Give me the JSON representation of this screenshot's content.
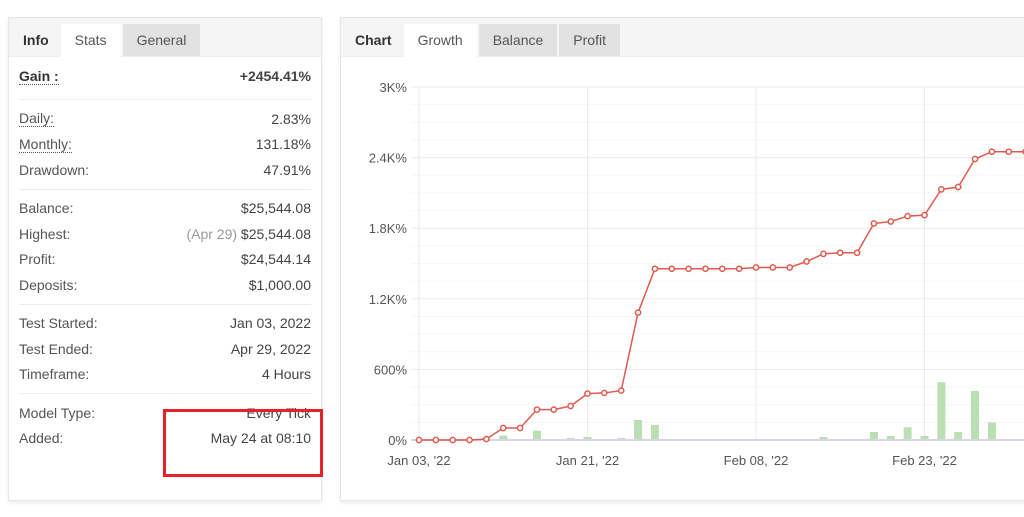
{
  "left_panel": {
    "tabs": [
      {
        "label": "Info"
      },
      {
        "label": "Stats"
      },
      {
        "label": "General"
      }
    ],
    "gain": {
      "label": "Gain :",
      "value": "+2454.41%"
    },
    "groups": [
      [
        {
          "label": "Daily:",
          "value": "2.83%",
          "dotted": true
        },
        {
          "label": "Monthly:",
          "value": "131.18%",
          "dotted": true
        },
        {
          "label": "Drawdown:",
          "value": "47.91%"
        }
      ],
      [
        {
          "label": "Balance:",
          "value": "$25,544.08"
        },
        {
          "label": "Highest:",
          "note": "(Apr 29)",
          "value": "$25,544.08"
        },
        {
          "label": "Profit:",
          "value": "$24,544.14",
          "green": true
        },
        {
          "label": "Deposits:",
          "value": "$1,000.00"
        }
      ],
      [
        {
          "label": "Test Started:",
          "value": "Jan 03, 2022"
        },
        {
          "label": "Test Ended:",
          "value": "Apr 29, 2022"
        },
        {
          "label": "Timeframe:",
          "value": "4 Hours"
        }
      ],
      [
        {
          "label": "Model Type:",
          "value": "Every Tick"
        },
        {
          "label": "Added:",
          "value": "May 24 at 08:10"
        }
      ]
    ],
    "highlight_color": "#e8202a",
    "positive_color": "#3aa63a"
  },
  "chart_panel": {
    "tabs": [
      {
        "label": "Chart"
      },
      {
        "label": "Growth"
      },
      {
        "label": "Balance"
      },
      {
        "label": "Profit"
      }
    ]
  },
  "chart_data": {
    "type": "line",
    "ylim": [
      0,
      3000
    ],
    "yticks": [
      {
        "v": 0,
        "label": "0%"
      },
      {
        "v": 600,
        "label": "600%"
      },
      {
        "v": 1200,
        "label": "1.2K%"
      },
      {
        "v": 1800,
        "label": "1.8K%"
      },
      {
        "v": 2400,
        "label": "2.4K%"
      },
      {
        "v": 3000,
        "label": "3K%"
      }
    ],
    "xticks": [
      {
        "i": 0,
        "label": "Jan 03, '22"
      },
      {
        "i": 10,
        "label": "Jan 21, '22"
      },
      {
        "i": 20,
        "label": "Feb 08, '22"
      },
      {
        "i": 30,
        "label": "Feb 23, '22"
      }
    ],
    "grid": true,
    "series": [
      {
        "type": "line",
        "color": "#e05a4f",
        "values": [
          0,
          0,
          0,
          0,
          8,
          102,
          102,
          258,
          258,
          289,
          394,
          400,
          420,
          1083,
          1455,
          1455,
          1455,
          1455,
          1455,
          1455,
          1466,
          1466,
          1466,
          1517,
          1582,
          1591,
          1591,
          1840,
          1857,
          1903,
          1911,
          2130,
          2150,
          2388,
          2450,
          2450,
          2450
        ]
      },
      {
        "type": "bar",
        "color": "#b9dfb2",
        "values": [
          0,
          0,
          0,
          0,
          0,
          37,
          0,
          79,
          0,
          17,
          26,
          8,
          17,
          170,
          128,
          0,
          0,
          0,
          0,
          0,
          6,
          0,
          0,
          6,
          26,
          6,
          0,
          68,
          34,
          108,
          34,
          491,
          68,
          417,
          150,
          0,
          0
        ]
      }
    ]
  }
}
